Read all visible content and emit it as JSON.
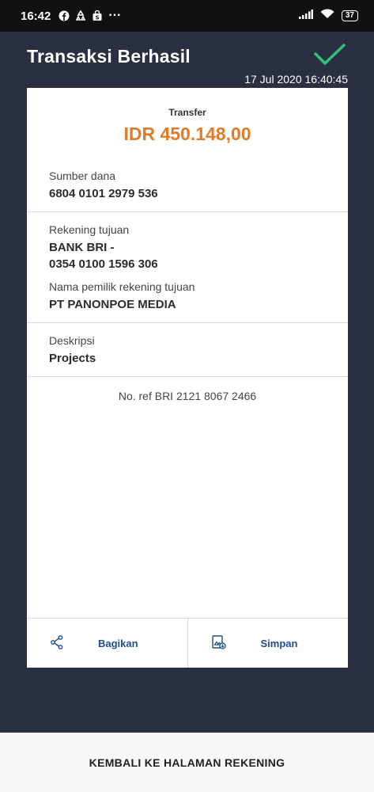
{
  "status_bar": {
    "time": "16:42",
    "dots": "···",
    "battery": "37"
  },
  "header": {
    "title": "Transaksi Berhasil",
    "datetime": "17 Jul 2020 16:40:45"
  },
  "receipt": {
    "type": "Transfer",
    "amount": "IDR 450.148,00",
    "source_label": "Sumber dana",
    "source_value": "6804 0101 2979 536",
    "dest_label": "Rekening tujuan",
    "dest_bank": "BANK BRI -",
    "dest_account": "0354 0100 1596 306",
    "owner_label": "Nama pemilik rekening tujuan",
    "owner_value": "PT PANONPOE MEDIA",
    "desc_label": "Deskripsi",
    "desc_value": "Projects",
    "reference": "No. ref BRI 2121 8067 2466"
  },
  "actions": {
    "share_label": "Bagikan",
    "save_label": "Simpan"
  },
  "footer": {
    "back_label": "KEMBALI KE HALAMAN REKENING"
  },
  "colors": {
    "background": "#2a3042",
    "amount": "#e07b26",
    "success": "#2fc27b",
    "action_text": "#1f4d8c"
  },
  "icons": [
    "facebook-icon",
    "recycle-icon",
    "bag-icon",
    "signal-icon",
    "wifi-icon",
    "battery-icon",
    "success-check-icon",
    "share-icon",
    "save-icon"
  ]
}
